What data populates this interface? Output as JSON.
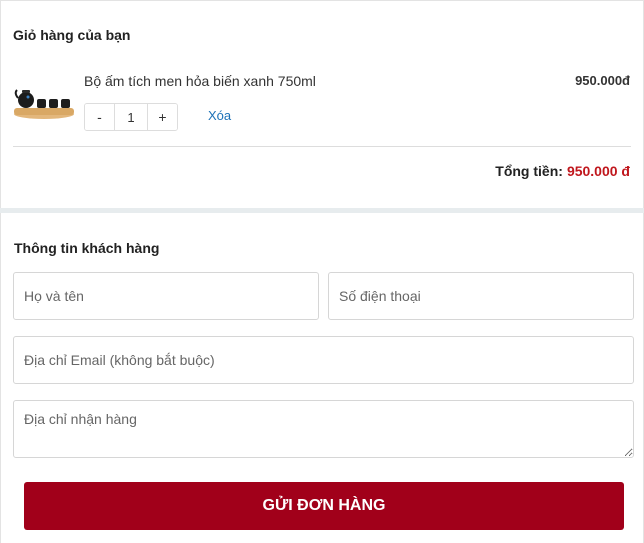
{
  "cart": {
    "title": "Giỏ hàng của bạn",
    "item": {
      "name": "Bộ ấm tích men hỏa biến xanh 750ml",
      "price": "950.000đ",
      "quantity": "1",
      "decrease_label": "-",
      "increase_label": "+",
      "remove_label": "Xóa"
    },
    "total_label": "Tổng tiền:",
    "total_value": "950.000 đ"
  },
  "customer": {
    "title": "Thông tin khách hàng",
    "name_placeholder": "Họ và tên",
    "phone_placeholder": "Số điện thoại",
    "email_placeholder": "Địa chỉ Email (không bắt buộc)",
    "address_placeholder": "Địa chỉ nhận hàng",
    "submit_label": "GỬI ĐƠN HÀNG"
  },
  "colors": {
    "accent_red": "#c0171d",
    "submit_bg": "#a1001a",
    "link_blue": "#1d72b8"
  },
  "icons": {
    "product_thumbnail": "teapot-set-image"
  }
}
